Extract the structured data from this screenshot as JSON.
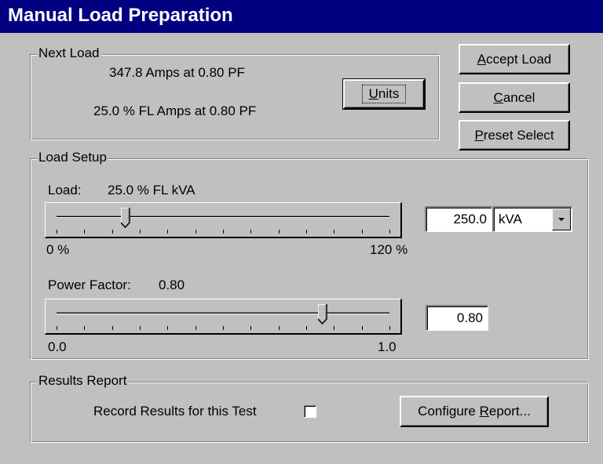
{
  "window": {
    "title": "Manual Load Preparation"
  },
  "next_load": {
    "legend": "Next Load",
    "line1": "347.8 Amps at 0.80 PF",
    "line2": "25.0 % FL Amps at 0.80 PF",
    "units_button": {
      "mnemonic": "U",
      "rest": "nits"
    }
  },
  "buttons": {
    "accept": {
      "mnemonic": "A",
      "rest": "ccept Load"
    },
    "cancel": {
      "mnemonic": "C",
      "rest": "ancel"
    },
    "preset": {
      "mnemonic": "P",
      "rest": "reset Select"
    }
  },
  "load_setup": {
    "legend": "Load Setup",
    "load": {
      "label": "Load:",
      "value_text": "25.0 % FL kVA",
      "min_label": "0 %",
      "max_label": "120 %",
      "slider_value": 25.0,
      "slider_min": 0,
      "slider_max": 120,
      "field_value": "250.0",
      "unit_selected": "kVA"
    },
    "power_factor": {
      "label": "Power Factor:",
      "value_text": "0.80",
      "min_label": "0.0",
      "max_label": "1.0",
      "slider_value": 0.8,
      "slider_min": 0,
      "slider_max": 1,
      "field_value": "0.80"
    }
  },
  "results_report": {
    "legend": "Results Report",
    "record_label": "Record Results for this Test",
    "record_checked": false,
    "configure_button": {
      "before": "Configure ",
      "mnemonic": "R",
      "rest": "eport..."
    }
  },
  "icons": {
    "dropdown": "chevron-down-icon",
    "slider_thumb": "slider-thumb-icon"
  }
}
